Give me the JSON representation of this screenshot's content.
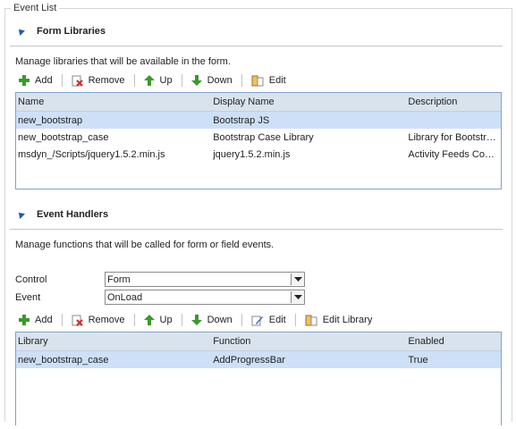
{
  "legend": "Event List",
  "form_libraries": {
    "title": "Form Libraries",
    "description": "Manage libraries that will be available in the form.",
    "toolbar": {
      "add": "Add",
      "remove": "Remove",
      "up": "Up",
      "down": "Down",
      "edit": "Edit"
    },
    "columns": [
      "Name",
      "Display Name",
      "Description"
    ],
    "rows": [
      {
        "name": "new_bootstrap",
        "display": "Bootstrap JS",
        "description": ""
      },
      {
        "name": "new_bootstrap_case",
        "display": "Bootstrap Case Library",
        "description": "Library for Bootstrap..."
      },
      {
        "name": "msdyn_/Scripts/jquery1.5.2.min.js",
        "display": "jquery1.5.2.min.js",
        "description": "Activity Feeds Compo..."
      }
    ]
  },
  "event_handlers": {
    "title": "Event Handlers",
    "description": "Manage functions that will be called for form or field events.",
    "control_label": "Control",
    "control_value": "Form",
    "event_label": "Event",
    "event_value": "OnLoad",
    "toolbar": {
      "add": "Add",
      "remove": "Remove",
      "up": "Up",
      "down": "Down",
      "edit": "Edit",
      "edit_library": "Edit Library"
    },
    "columns": [
      "Library",
      "Function",
      "Enabled"
    ],
    "rows": [
      {
        "library": "new_bootstrap_case",
        "function": "AddProgressBar",
        "enabled": "True"
      }
    ]
  }
}
